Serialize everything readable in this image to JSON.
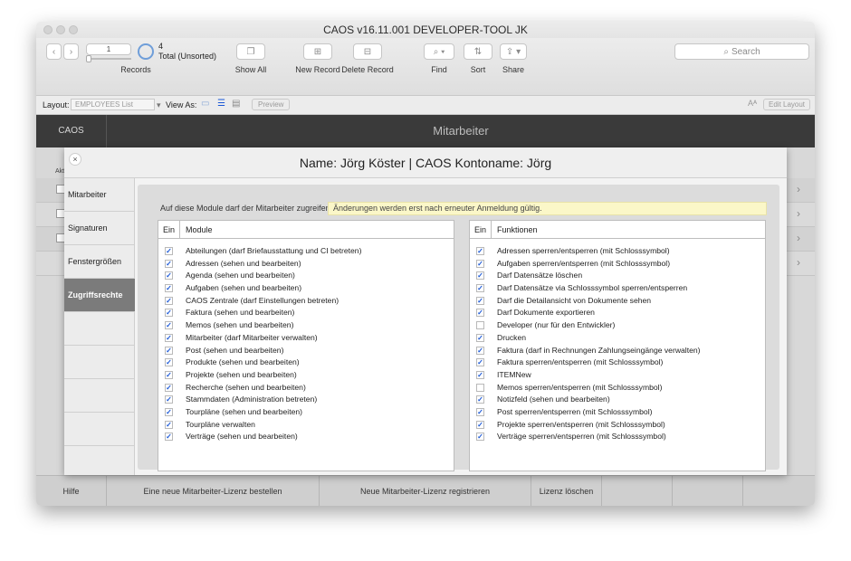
{
  "window": {
    "title": "CAOS v16.11.001  DEVELOPER-TOOL JK"
  },
  "toolbar": {
    "record_number": "1",
    "records_count": "4",
    "records_status": "Total (Unsorted)",
    "records_label": "Records",
    "show_all": "Show All",
    "new_record": "New Record",
    "delete_record": "Delete Record",
    "find": "Find",
    "sort": "Sort",
    "share": "Share",
    "search_placeholder": "Search"
  },
  "layoutbar": {
    "layout_label": "Layout:",
    "layout_value": "EMPLOYEES List",
    "view_as_label": "View As:",
    "preview": "Preview",
    "edit_layout": "Edit Layout",
    "font_size_icon": "Aᴬ"
  },
  "header": {
    "app": "CAOS",
    "title": "Mitarbeiter",
    "col_hint": "Akt"
  },
  "dialog": {
    "title": "Name: Jörg Köster  |  CAOS Kontoname: Jörg",
    "close": "×",
    "sidebar": [
      {
        "label": "Mitarbeiter",
        "active": false
      },
      {
        "label": "Signaturen",
        "active": false
      },
      {
        "label": "Fenstergrößen",
        "active": false
      },
      {
        "label": "Zugriffsrechte",
        "active": true
      }
    ],
    "access_label": "Auf diese Module darf der Mitarbeiter zugreifen:",
    "notice": "Änderungen werden erst nach erneuter Anmeldung gültig.",
    "modules": {
      "col_enabled": "Ein",
      "col_name": "Module",
      "rows": [
        {
          "label": "Abteilungen (darf Briefausstattung und CI betreten)",
          "checked": true
        },
        {
          "label": "Adressen (sehen und bearbeiten)",
          "checked": true
        },
        {
          "label": "Agenda (sehen und bearbeiten)",
          "checked": true
        },
        {
          "label": "Aufgaben (sehen und bearbeiten)",
          "checked": true
        },
        {
          "label": "CAOS Zentrale (darf Einstellungen betreten)",
          "checked": true
        },
        {
          "label": "Faktura (sehen und bearbeiten)",
          "checked": true
        },
        {
          "label": "Memos (sehen und bearbeiten)",
          "checked": true
        },
        {
          "label": "Mitarbeiter (darf Mitarbeiter verwalten)",
          "checked": true
        },
        {
          "label": "Post (sehen und bearbeiten)",
          "checked": true
        },
        {
          "label": "Produkte  (sehen und bearbeiten)",
          "checked": true
        },
        {
          "label": "Projekte (sehen und bearbeiten)",
          "checked": true
        },
        {
          "label": "Recherche (sehen und bearbeiten)",
          "checked": true
        },
        {
          "label": "Stammdaten (Administration betreten)",
          "checked": true
        },
        {
          "label": "Tourpläne (sehen und bearbeiten)",
          "checked": true
        },
        {
          "label": "Tourpläne verwalten",
          "checked": true
        },
        {
          "label": "Verträge (sehen und bearbeiten)",
          "checked": true
        }
      ]
    },
    "functions": {
      "col_enabled": "Ein",
      "col_name": "Funktionen",
      "rows": [
        {
          "label": "Adressen sperren/entsperren (mit Schlosssymbol)",
          "checked": true
        },
        {
          "label": "Aufgaben sperren/entsperren (mit Schlosssymbol)",
          "checked": true
        },
        {
          "label": "Darf Datensätze löschen",
          "checked": true
        },
        {
          "label": "Darf Datensätze via Schlosssymbol sperren/entsperren",
          "checked": true
        },
        {
          "label": "Darf die Detailansicht von Dokumente sehen",
          "checked": true
        },
        {
          "label": "Darf Dokumente exportieren",
          "checked": true
        },
        {
          "label": "Developer (nur für den Entwickler)",
          "checked": false
        },
        {
          "label": "Drucken",
          "checked": true
        },
        {
          "label": "Faktura (darf in Rechnungen Zahlungseingänge verwalten)",
          "checked": true
        },
        {
          "label": "Faktura sperren/entsperren (mit Schlosssymbol)",
          "checked": true
        },
        {
          "label": "ITEMNew",
          "checked": true
        },
        {
          "label": "Memos sperren/entsperren (mit Schlosssymbol)",
          "checked": false
        },
        {
          "label": "Notizfeld (sehen und bearbeiten)",
          "checked": true
        },
        {
          "label": "Post sperren/entsperren (mit Schlosssymbol)",
          "checked": true
        },
        {
          "label": "Projekte sperren/entsperren (mit Schlosssymbol)",
          "checked": true
        },
        {
          "label": "Verträge sperren/entsperren (mit Schlosssymbol)",
          "checked": true
        }
      ]
    }
  },
  "bottom": {
    "help": "Hilfe",
    "order_license": "Eine neue Mitarbeiter-Lizenz bestellen",
    "register_license": "Neue Mitarbeiter-Lizenz registrieren",
    "delete_license": "Lizenz löschen"
  },
  "colors": {
    "accent": "#1a57d6",
    "dark": "#3a3a3a",
    "notice_bg": "#fbf7c8",
    "active_tab": "#7b7b7b"
  }
}
